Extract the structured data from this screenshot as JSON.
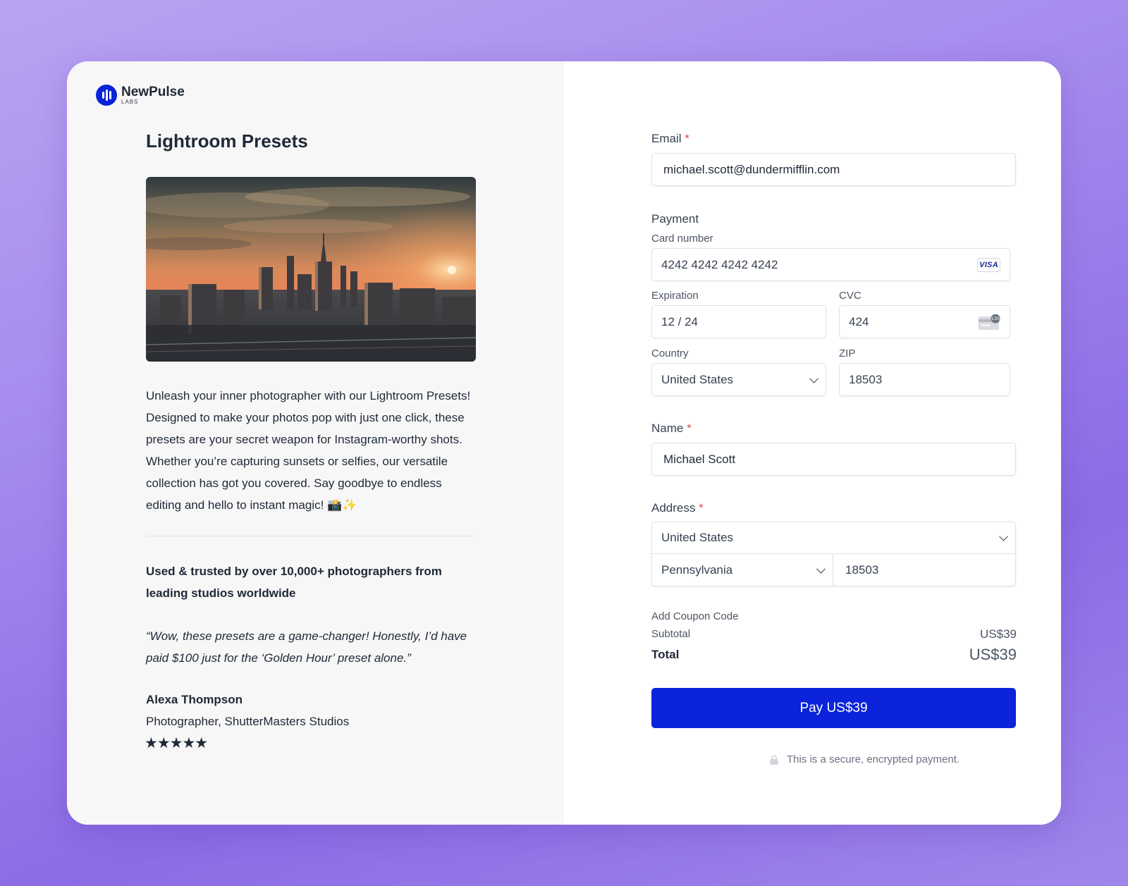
{
  "brand": {
    "name": "NewPulse",
    "sub": "LABS",
    "color": "#0a23d8"
  },
  "product": {
    "title": "Lightroom Presets",
    "description": "Unleash your inner photographer with our Lightroom Presets! Designed to make your photos pop with just one click, these presets are your secret weapon for Instagram-worthy shots. Whether you’re capturing sunsets or selfies, our versatile collection has got you covered. Say goodbye to endless editing and hello to instant magic! 📸✨",
    "trusted": "Used & trusted by over 10,000+ photographers from leading studios worldwide",
    "quote": "“Wow, these presets are a game-changer! Honestly, I’d have paid $100 just for the ‘Golden Hour’ preset alone.”",
    "reviewer_name": "Alexa Thompson",
    "reviewer_role": "Photographer, ShutterMasters Studios",
    "stars": "★★★★★",
    "rating": 5
  },
  "form": {
    "email_label": "Email",
    "required_mark": "*",
    "email_value": "michael.scott@dundermifflin.com",
    "payment_label": "Payment",
    "card_number_label": "Card number",
    "card_number_value": "4242 4242 4242 4242",
    "card_brand": "VISA",
    "expiration_label": "Expiration",
    "expiration_value": "12 / 24",
    "cvc_label": "CVC",
    "cvc_value": "424",
    "cvc_icon_text": "135",
    "country_label": "Country",
    "country_value": "United States",
    "zip_label": "ZIP",
    "zip_value": "18503",
    "name_label": "Name",
    "name_value": "Michael Scott",
    "address_label": "Address",
    "address_country": "United States",
    "address_state": "Pennsylvania",
    "address_zip": "18503"
  },
  "summary": {
    "coupon": "Add Coupon Code",
    "subtotal_label": "Subtotal",
    "subtotal_value": "US$39",
    "total_label": "Total",
    "total_value": "US$39",
    "pay_button": "Pay US$39",
    "secure_note": "This is a secure, encrypted payment."
  },
  "colors": {
    "accent": "#0a23db",
    "required": "#e5484d",
    "background": "#a58aed"
  }
}
